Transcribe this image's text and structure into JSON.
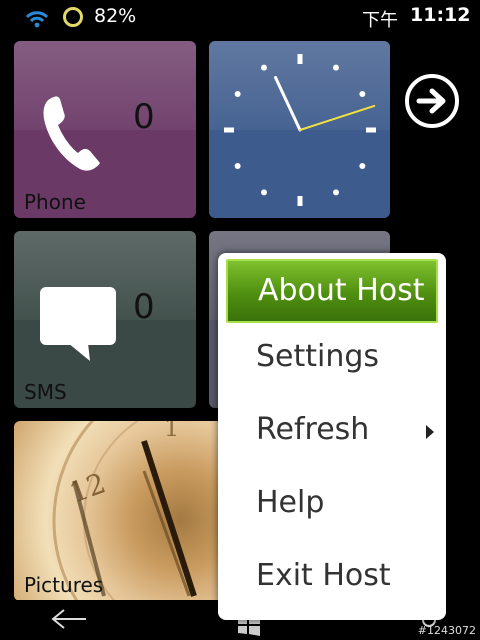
{
  "status": {
    "battery": "82%",
    "time_prefix": "下午",
    "time": "11:12"
  },
  "tiles": {
    "phone": {
      "label": "Phone",
      "count": "0"
    },
    "sms": {
      "label": "SMS",
      "count": "0"
    },
    "pictures": {
      "label": "Pictures"
    }
  },
  "clock": {
    "hour_angle_deg": 335,
    "minute_angle_deg": 72
  },
  "menu": {
    "items": [
      {
        "label": "About Host",
        "selected": true
      },
      {
        "label": "Settings"
      },
      {
        "label": "Refresh",
        "has_submenu": true
      },
      {
        "label": "Help"
      },
      {
        "label": "Exit Host"
      }
    ]
  },
  "watermark": "#1243072",
  "colors": {
    "phone_tile": "#6a3966",
    "clock_tile": "#3d5b8c",
    "sms_tile": "#3a4945",
    "menu_selected": "#5a9a14",
    "battery_ring": "#e3d86a",
    "wifi": "#2a8ad8"
  },
  "icons": [
    "wifi-icon",
    "battery-icon",
    "phone-icon",
    "message-icon",
    "forward-arrow-icon",
    "back-arrow-icon",
    "windows-start-icon",
    "search-icon",
    "chevron-right-icon"
  ]
}
